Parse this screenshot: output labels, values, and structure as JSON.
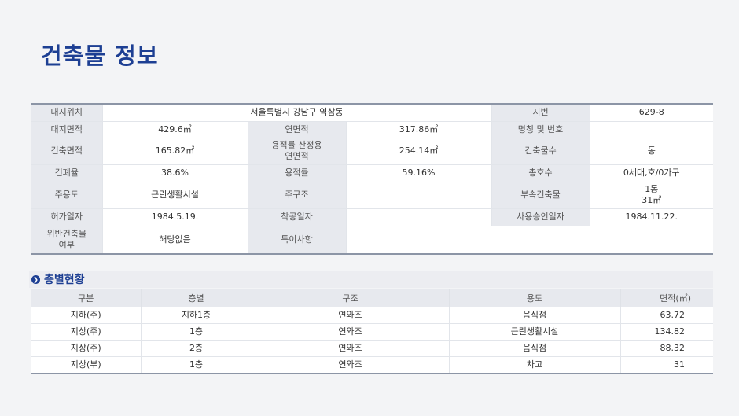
{
  "page": {
    "title": "건축물 정보"
  },
  "info": {
    "r1": {
      "l1": "대지위치",
      "v1": "서울특별시 강남구 역삼동",
      "l2": "지번",
      "v2": "629-8"
    },
    "r2": {
      "l1": "대지면적",
      "v1": "429.6㎡",
      "l2": "연면적",
      "v2": "317.86㎡",
      "l3": "명칭 및 번호",
      "v3": ""
    },
    "r3": {
      "l1": "건축면적",
      "v1": "165.82㎡",
      "l2a": "용적률 산정용",
      "l2b": "연면적",
      "v2": "254.14㎡",
      "l3": "건축물수",
      "v3": "동"
    },
    "r4": {
      "l1": "건폐율",
      "v1": "38.6%",
      "l2": "용적률",
      "v2": "59.16%",
      "l3": "총호수",
      "v3": "0세대,호/0가구"
    },
    "r5": {
      "l1": "주용도",
      "v1": "근린생활시설",
      "l2": "주구조",
      "v2": "",
      "l3": "부속건축물",
      "v3a": "1동",
      "v3b": "31㎡"
    },
    "r6": {
      "l1": "허가일자",
      "v1": "1984.5.19.",
      "l2": "착공일자",
      "v2": "",
      "l3": "사용승인일자",
      "v3": "1984.11.22."
    },
    "r7": {
      "l1a": "위반건축물",
      "l1b": "여부",
      "v1": "해당없음",
      "l2": "특이사항",
      "v2": ""
    }
  },
  "floors": {
    "section_title": "층별현황",
    "headers": [
      "구분",
      "층별",
      "구조",
      "용도",
      "면적(㎡)"
    ],
    "rows": [
      [
        "지하(주)",
        "지하1층",
        "연와조",
        "음식점",
        "63.72"
      ],
      [
        "지상(주)",
        "1층",
        "연와조",
        "근린생활시설",
        "134.82"
      ],
      [
        "지상(주)",
        "2층",
        "연와조",
        "음식점",
        "88.32"
      ],
      [
        "지상(부)",
        "1층",
        "연와조",
        "차고",
        "31"
      ]
    ]
  }
}
